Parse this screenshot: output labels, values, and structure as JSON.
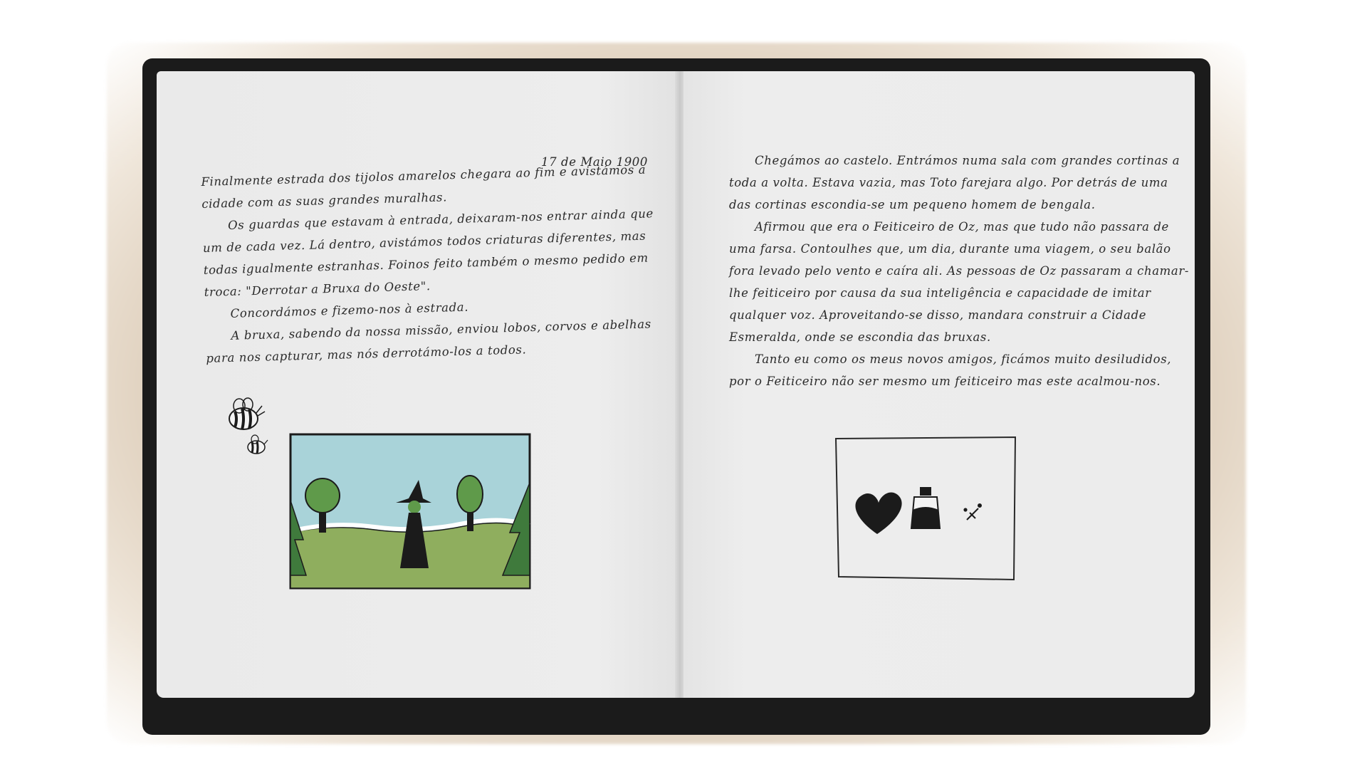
{
  "left_page": {
    "date": "17 de Maio 1900",
    "paragraphs": [
      "Finalmente estrada dos tijolos amarelos chegara ao fim e avistámos a cidade com as suas grandes muralhas.",
      "Os guardas que estavam à entrada, deixaram-nos entrar ainda que um de cada vez. Lá dentro, avistámos todos criaturas diferentes, mas todas igualmente estranhas. Foinos feito também o mesmo pedido em troca: \"Derrotar a Bruxa do Oeste\".",
      "Concordámos e fizemo-nos à estrada.",
      "A bruxa, sabendo da nossa missão, enviou lobos, corvos e abelhas para nos capturar, mas nós derrotámo-los a todos."
    ],
    "illustration_icon": "witch-in-meadow-drawing",
    "bees_icon": "bees-icon"
  },
  "right_page": {
    "paragraphs": [
      "Chegámos ao castelo. Entrámos numa sala com grandes cortinas a toda a volta. Estava vazia, mas Toto farejara algo. Por detrás de uma das cortinas escondia-se um pequeno homem de bengala.",
      "Afirmou que era o Feiticeiro de Oz, mas que tudo não passara de uma farsa. Contoulhes que, um dia, durante uma viagem, o seu balão fora levado pelo vento e caíra ali. As pessoas de Oz passaram a chamar-lhe feiticeiro por causa da sua inteligência e capacidade de imitar qualquer voz. Aproveitando-se disso, mandara construir a Cidade Esmeralda, onde se escondia das bruxas.",
      "Tanto eu como os meus novos amigos, ficámos muito desiludidos, por o Feiticeiro não ser mesmo um feiticeiro mas este acalmou-nos."
    ],
    "illustration_icon": "heart-jar-sparkle-drawing"
  },
  "colors": {
    "frame": "#1b1b1b",
    "page": "#ececec",
    "sky": "#a9d3d9",
    "grass": "#8fae5e",
    "tree": "#5f9a4a",
    "ink": "#2a2a2a"
  }
}
